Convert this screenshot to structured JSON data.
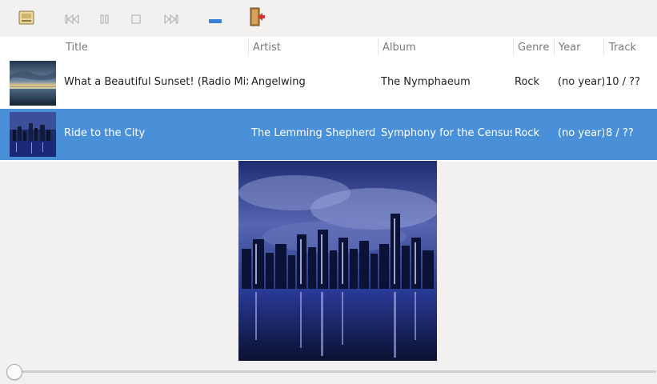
{
  "toolbar": {
    "buttons": [
      {
        "name": "open-playlist-button",
        "icon": "playlist-icon"
      },
      {
        "name": "previous-button",
        "icon": "skip-back-icon"
      },
      {
        "name": "pause-button",
        "icon": "pause-icon"
      },
      {
        "name": "stop-button",
        "icon": "stop-icon"
      },
      {
        "name": "next-button",
        "icon": "skip-forward-icon"
      },
      {
        "name": "remove-button",
        "icon": "minus-icon"
      },
      {
        "name": "quit-button",
        "icon": "exit-icon"
      }
    ]
  },
  "table": {
    "headers": {
      "title": "Title",
      "artist": "Artist",
      "album": "Album",
      "genre": "Genre",
      "year": "Year",
      "track": "Track"
    },
    "rows": [
      {
        "title": "What a Beautiful Sunset! (Radio Mix)",
        "artist": "Angelwing",
        "album": "The Nymphaeum",
        "genre": "Rock",
        "year": "(no year)",
        "track": "10 / ??",
        "selected": false
      },
      {
        "title": "Ride to the City",
        "artist": "The Lemming Shepherds",
        "album": "Symphony for the Census",
        "genre": "Rock",
        "year": "(no year)",
        "track": "8 / ??",
        "selected": true
      }
    ]
  },
  "colors": {
    "selection": "#4a90d9",
    "background": "#f2f1f0",
    "list_background": "#ffffff",
    "remove_accent": "#3d7fd6",
    "quit_accent": "#d6342c"
  },
  "player": {
    "progress": 0.0
  }
}
